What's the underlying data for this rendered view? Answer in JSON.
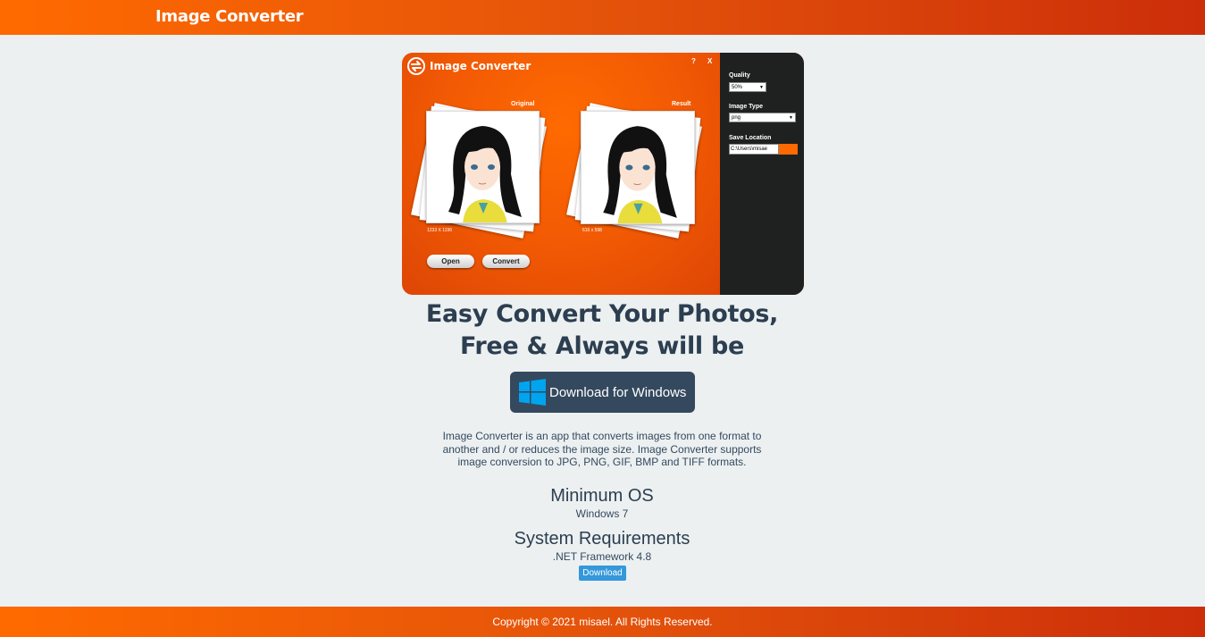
{
  "header": {
    "brand": "Image Converter"
  },
  "preview": {
    "title": "Image Converter",
    "help": "?",
    "close": "X",
    "original_label": "Original",
    "result_label": "Result",
    "original_dims": "1233 X 1196",
    "result_dims": "616 x 598",
    "open_button": "Open",
    "convert_button": "Convert",
    "quality_label": "Quality",
    "quality_value": "50%",
    "type_label": "Image Type",
    "type_value": "png",
    "location_label": "Save Location",
    "location_value": "C:\\Users\\misae"
  },
  "hero": {
    "line1": "Easy Convert Your Photos,",
    "line2": "Free & Always will be"
  },
  "download_windows": "Download for Windows",
  "description": "Image Converter is an app that converts images from one format to another and / or reduces the image size. Image Converter supports image conversion to JPG, PNG, GIF, BMP and TIFF formats.",
  "min_os": {
    "title": "Minimum OS",
    "value": "Windows 7"
  },
  "requirements": {
    "title": "System Requirements",
    "value": ".NET Framework 4.8",
    "download": "Download"
  },
  "footer": {
    "copyright": "Copyright © 2021 misael. All Rights Reserved."
  },
  "colors": {
    "orange": "#ff6a00",
    "dark": "#34495e",
    "blue": "#3498db",
    "windows_blue": "#00a4ef"
  }
}
